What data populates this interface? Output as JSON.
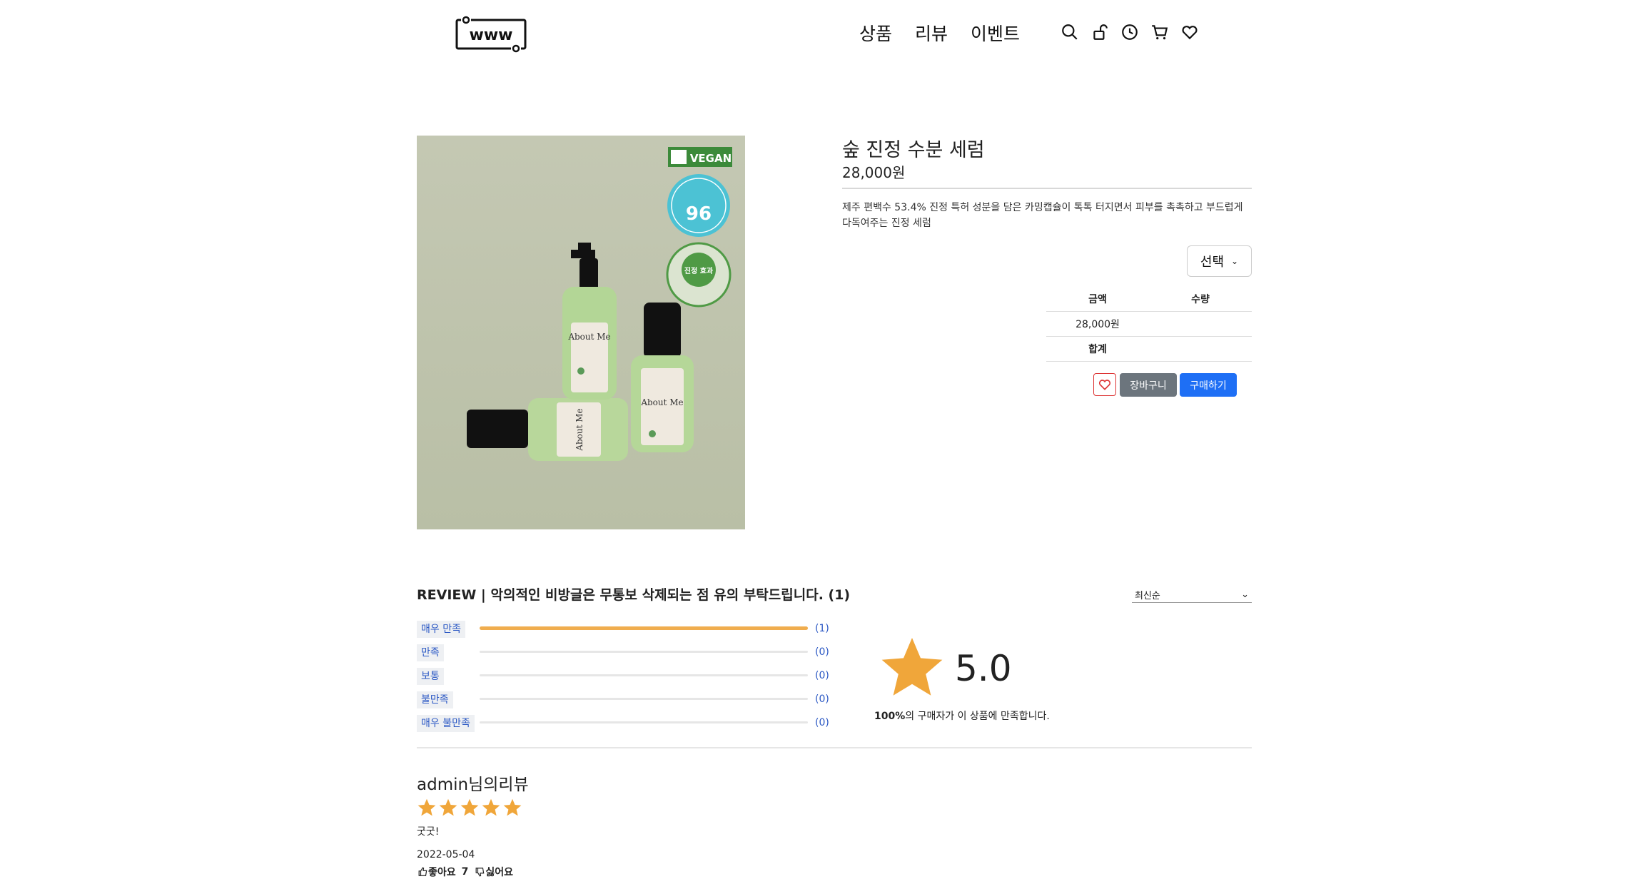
{
  "header": {
    "logo_text": "www",
    "nav": [
      "상품",
      "리뷰",
      "이벤트"
    ],
    "icons": [
      "search-icon",
      "lock-icon",
      "history-icon",
      "cart-icon",
      "heart-icon"
    ]
  },
  "product": {
    "title": "숲 진정 수분 세럼",
    "price": "28,000원",
    "description": "제주 편백수 53.4% 진정 특허 성분을 담은 카밍캡슐이 톡톡 터지면서 피부를 촉촉하고 부드럽게 다독여주는 진정 세럼",
    "image": {
      "vegan_badge": "VEGAN",
      "percent_badge": "96",
      "calm_badge": "진정 효과",
      "brand": "About Me"
    },
    "option_select": "선택",
    "table": {
      "headers": [
        "금액",
        "수량"
      ],
      "row": [
        "28,000원",
        ""
      ],
      "total_label": "합계"
    },
    "cart_button": "장바구니",
    "buy_button": "구매하기"
  },
  "reviews": {
    "title": "REVIEW | 악의적인 비방글은 무통보 삭제되는 점 유의 부탁드립니다. (1)",
    "sort": "최신순",
    "ratings": [
      {
        "label": "매우 만족",
        "count": "(1)",
        "fraction": 1.0
      },
      {
        "label": "만족",
        "count": "(0)",
        "fraction": 0
      },
      {
        "label": "보통",
        "count": "(0)",
        "fraction": 0
      },
      {
        "label": "불만족",
        "count": "(0)",
        "fraction": 0
      },
      {
        "label": "매우 불만족",
        "count": "(0)",
        "fraction": 0
      }
    ],
    "average_score": "5.0",
    "satisfaction_percent": "100%",
    "satisfaction_text": "의 구매자가 이 상품에 만족합니다.",
    "items": [
      {
        "author": "admin님의리뷰",
        "stars": 5,
        "text": "굿굿!",
        "date": "2022-05-04",
        "like_label": "좋아요",
        "like_count": "7",
        "dislike_label": "싫어요"
      }
    ]
  },
  "colors": {
    "star": "#f0ad4e",
    "buy_button": "#1e6ff5",
    "cart_button": "#6c757d",
    "rating_label": "#2b58c4"
  }
}
